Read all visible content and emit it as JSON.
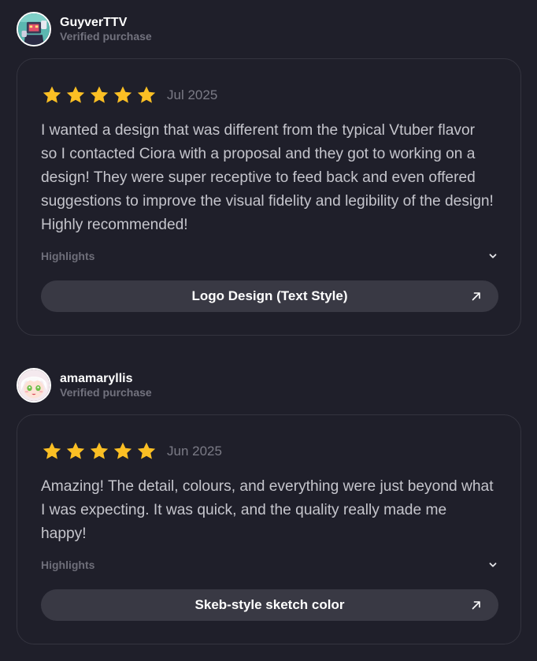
{
  "colors": {
    "background": "#1f1f2a",
    "card_border": "#34343f",
    "star": "#fbbf24",
    "button_bg": "#393944",
    "muted_text": "#72727e"
  },
  "reviews": [
    {
      "reviewer": {
        "name": "GuyverTTV",
        "verified_label": "Verified purchase",
        "avatar_icon": "avatar-robot"
      },
      "rating": 5,
      "date": "Jul 2025",
      "body": "I wanted a design that was different from the typical Vtuber flavor so I contacted Ciora with a proposal and they got to working on a design! They were super receptive to feed back and even offered suggestions to improve the visual fidelity and legibility of the design! Highly recommended!",
      "highlights_label": "Highlights",
      "service_label": "Logo Design (Text Style)"
    },
    {
      "reviewer": {
        "name": "amamaryllis",
        "verified_label": "Verified purchase",
        "avatar_icon": "avatar-anime-girl"
      },
      "rating": 5,
      "date": "Jun 2025",
      "body": "Amazing! The detail, colours, and everything were just beyond what I was expecting. It was quick, and the quality really made me happy!",
      "highlights_label": "Highlights",
      "service_label": "Skeb-style sketch color"
    }
  ]
}
